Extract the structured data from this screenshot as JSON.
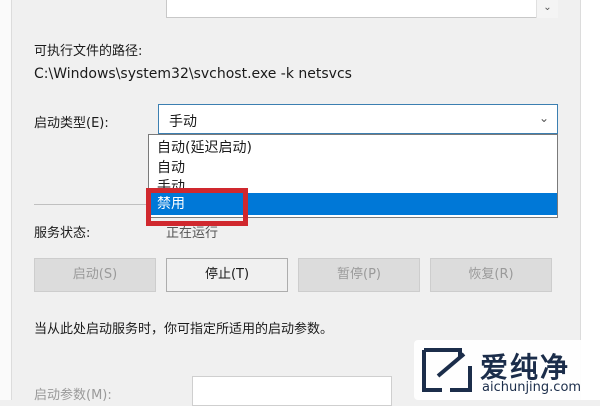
{
  "service": {
    "path_label": "可执行文件的路径:",
    "path_value": "C:\\Windows\\system32\\svchost.exe -k netsvcs",
    "startup_type_label": "启动类型(E):",
    "startup_type_value": "手动",
    "startup_options": [
      "自动(延迟启动)",
      "自动",
      "手动",
      "禁用"
    ],
    "highlighted_option": "禁用",
    "status_label": "服务状态:",
    "status_value": "正在运行"
  },
  "buttons": {
    "start": "启动(S)",
    "stop": "停止(T)",
    "pause": "暂停(P)",
    "resume": "恢复(R)"
  },
  "hint_text": "当从此处启动服务时，你可指定所适用的启动参数。",
  "params_label": "启动参数(M):",
  "watermark": {
    "title": "爱纯净",
    "subtitle": "aichunjing.com"
  },
  "icons": {
    "dropdown_arrow": "chevron-down-icon",
    "scroll_arrow": "chevron-down-icon",
    "watermark_logo": "logo-icon"
  },
  "colors": {
    "selection": "#0078d7",
    "highlight_box": "#d0282e",
    "select_border": "#3c7fb1"
  }
}
